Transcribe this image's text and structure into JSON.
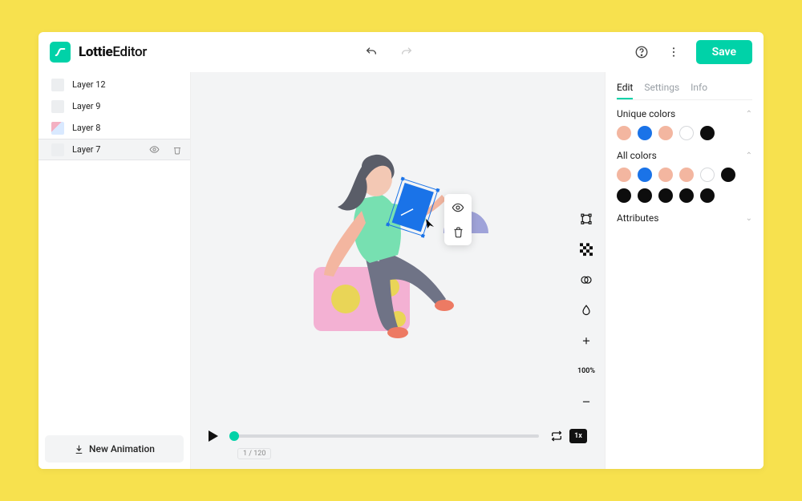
{
  "header": {
    "brand_bold": "Lottie",
    "brand_thin": "Editor",
    "save_label": "Save"
  },
  "left": {
    "layers": [
      {
        "label": "Layer 12",
        "selected": false,
        "pic": false
      },
      {
        "label": "Layer 9",
        "selected": false,
        "pic": false
      },
      {
        "label": "Layer 8",
        "selected": false,
        "pic": true
      },
      {
        "label": "Layer 7",
        "selected": true,
        "pic": false
      }
    ],
    "new_animation_label": "New Animation"
  },
  "canvas": {
    "frame_counter": "1 / 120",
    "speed_label": "1x",
    "zoom_label": "100%"
  },
  "right": {
    "tabs": [
      {
        "label": "Edit",
        "active": true
      },
      {
        "label": "Settings",
        "active": false
      },
      {
        "label": "Info",
        "active": false
      }
    ],
    "unique_title": "Unique colors",
    "unique_colors": [
      {
        "hex": "#f3b6a0"
      },
      {
        "hex": "#1a73e8"
      },
      {
        "hex": "#f3b6a0"
      },
      {
        "hex": "#ffffff",
        "hollow": true
      },
      {
        "hex": "#0d0d0d"
      }
    ],
    "all_title": "All colors",
    "all_colors": [
      {
        "hex": "#f3b6a0"
      },
      {
        "hex": "#1a73e8"
      },
      {
        "hex": "#f3b6a0"
      },
      {
        "hex": "#f3b6a0"
      },
      {
        "hex": "#ffffff",
        "hollow": true
      },
      {
        "hex": "#0d0d0d"
      },
      {
        "hex": "#0d0d0d"
      },
      {
        "hex": "#0d0d0d"
      },
      {
        "hex": "#0d0d0d"
      },
      {
        "hex": "#0d0d0d"
      },
      {
        "hex": "#0d0d0d"
      }
    ],
    "attributes_title": "Attributes"
  }
}
